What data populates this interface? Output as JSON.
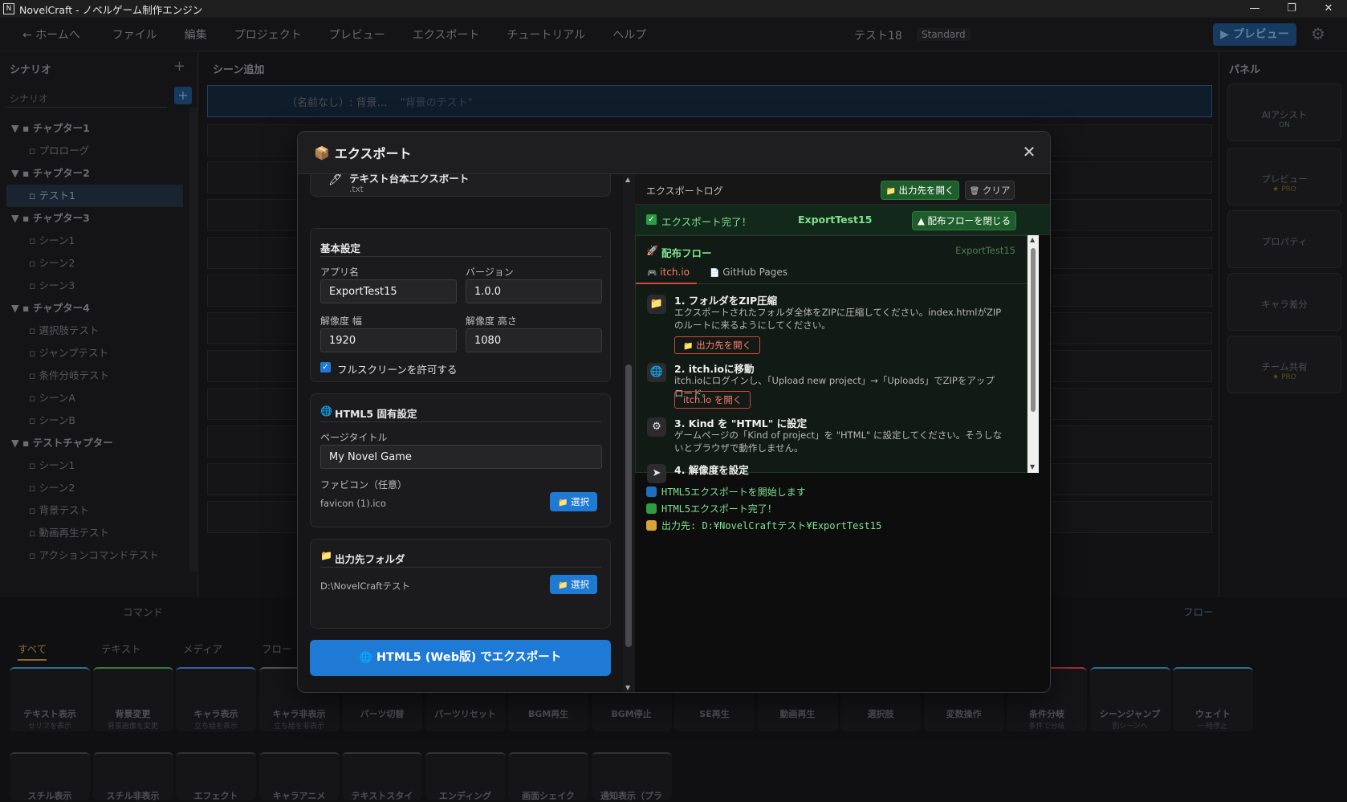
{
  "window": {
    "title": "NovelCraft - ノベルゲーム制作エンジン"
  },
  "menubar": {
    "home": "← ホームへ",
    "items": [
      "ファイル",
      "編集",
      "プロジェクト",
      "プレビュー",
      "エクスポート",
      "チュートリアル",
      "ヘルプ"
    ],
    "project_name": "テスト18",
    "plan": "Standard",
    "preview_button": "▶ プレビュー"
  },
  "sidebar": {
    "title": "シナリオ",
    "search_placeholder": "シナリオ",
    "tree": [
      {
        "type": "chapter",
        "label": "チャプター1"
      },
      {
        "type": "scene",
        "label": "プロローグ"
      },
      {
        "type": "chapter",
        "label": "チャプター2"
      },
      {
        "type": "scene",
        "label": "テスト1",
        "selected": true
      },
      {
        "type": "chapter",
        "label": "チャプター3"
      },
      {
        "type": "scene",
        "label": "シーン1"
      },
      {
        "type": "scene",
        "label": "シーン2"
      },
      {
        "type": "scene",
        "label": "シーン3"
      },
      {
        "type": "chapter",
        "label": "チャプター4"
      },
      {
        "type": "scene",
        "label": "選択肢テスト"
      },
      {
        "type": "scene",
        "label": "ジャンプテスト"
      },
      {
        "type": "scene",
        "label": "条件分岐テスト"
      },
      {
        "type": "scene",
        "label": "シーンA"
      },
      {
        "type": "scene",
        "label": "シーンB"
      },
      {
        "type": "chapter",
        "label": "テストチャプター"
      },
      {
        "type": "scene",
        "label": "シーン1"
      },
      {
        "type": "scene",
        "label": "シーン2"
      },
      {
        "type": "scene",
        "label": "背景テスト"
      },
      {
        "type": "scene",
        "label": "動画再生テスト"
      },
      {
        "type": "scene",
        "label": "アクションコマンドテスト"
      }
    ]
  },
  "center": {
    "title": "シーン追加",
    "first_row": "（名前なし）: 背景…",
    "first_row_hint": "\"背景のテスト\""
  },
  "right_panel": {
    "title": "パネル",
    "cards": [
      {
        "label": "AIアシスト",
        "sub": "ON"
      },
      {
        "label": "プレビュー",
        "sub": "★ PRO"
      },
      {
        "label": "プロパティ",
        "sub": ""
      },
      {
        "label": "キャラ差分",
        "sub": ""
      },
      {
        "label": "チーム共有",
        "sub": "★ PRO"
      }
    ]
  },
  "bottom": {
    "command_label": "コマンド",
    "flow_label": "フロー",
    "tabs": [
      "すべて",
      "テキスト",
      "メディア",
      "フロー"
    ],
    "tiles_row1": [
      {
        "label": "テキスト表示",
        "sub": "セリフを表示"
      },
      {
        "label": "背景変更",
        "sub": "背景画像を変更"
      },
      {
        "label": "キャラ表示",
        "sub": "立ち絵を表示"
      },
      {
        "label": "キャラ非表示",
        "sub": "立ち絵を非表示"
      },
      {
        "label": "パーツ切替",
        "sub": ""
      },
      {
        "label": "パーツリセット",
        "sub": ""
      },
      {
        "label": "BGM再生",
        "sub": ""
      },
      {
        "label": "BGM停止",
        "sub": ""
      },
      {
        "label": "SE再生",
        "sub": ""
      },
      {
        "label": "動画再生",
        "sub": ""
      },
      {
        "label": "選択肢",
        "sub": ""
      },
      {
        "label": "変数操作",
        "sub": ""
      },
      {
        "label": "条件分岐",
        "sub": "条件で分岐"
      },
      {
        "label": "シーンジャンプ",
        "sub": "別シーンへ"
      },
      {
        "label": "ウェイト",
        "sub": "一時停止"
      }
    ],
    "tiles_row2": [
      "スチル表示",
      "スチル非表示",
      "エフェクト",
      "キャラアニメ",
      "テキストスタイ",
      "エンディング",
      "画面シェイク",
      "通知表示（プラ"
    ]
  },
  "modal": {
    "title": "エクスポート",
    "text_export": {
      "title": "テキスト台本エクスポート",
      "ext": ".txt"
    },
    "basic": {
      "title": "基本設定",
      "app_name_label": "アプリ名",
      "app_name": "ExportTest15",
      "version_label": "バージョン",
      "version": "1.0.0",
      "width_label": "解像度 幅",
      "width": "1920",
      "height_label": "解像度 高さ",
      "height": "1080",
      "fullscreen_label": "フルスクリーンを許可する",
      "fullscreen": true
    },
    "html5": {
      "title": "HTML5 固有設定",
      "page_title_label": "ページタイトル",
      "page_title": "My Novel Game",
      "favicon_label": "ファビコン（任意）",
      "favicon_value": "favicon (1).ico",
      "select_label": "選択"
    },
    "output": {
      "title": "出力先フォルダ",
      "path": "D:\\NovelCraftテスト",
      "select_label": "選択"
    },
    "export_button": "HTML5 (Web版) でエクスポート",
    "log": {
      "title": "エクスポートログ",
      "open_output": "出力先を開く",
      "clear": "クリア",
      "done_text": "エクスポート完了！",
      "done_name": "ExportTest15",
      "close_flow": "▲ 配布フローを閉じる",
      "flow_title": "配布フロー",
      "flow_name": "ExportTest15",
      "tabs": [
        "itch.io",
        "GitHub Pages"
      ],
      "steps": [
        {
          "title": "1. フォルダをZIP圧縮",
          "desc": "エクスポートされたフォルダ全体をZIPに圧縮してください。index.htmlがZIPのルートに来るようにしてください。",
          "button": "出力先を開く"
        },
        {
          "title": "2. itch.ioに移動",
          "desc": "itch.ioにログインし、「Upload new project」→「Uploads」でZIPをアップロード。",
          "button": "itch.io を開く"
        },
        {
          "title": "3. Kind を \"HTML\" に設定",
          "desc": "ゲームページの「Kind of project」を \"HTML\" に設定してください。そうしないとブラウザで動作しません。",
          "button": ""
        },
        {
          "title": "4. 解像度を設定",
          "desc": "",
          "button": ""
        }
      ],
      "lines": [
        {
          "text": "HTML5エクスポートを開始します",
          "icon": "globe-icon",
          "color": "#7ee28e"
        },
        {
          "text": "HTML5エクスポート完了！",
          "icon": "check-icon",
          "color": "#7ee28e"
        },
        {
          "text": "出力先: D:¥NovelCraftテスト¥ExportTest15",
          "icon": "folder-icon",
          "color": "#7ee28e"
        }
      ]
    }
  },
  "colors": {
    "accent": "#1f7ad6",
    "success": "#7ee28e",
    "danger": "#d6463c",
    "bg": "#121214"
  }
}
